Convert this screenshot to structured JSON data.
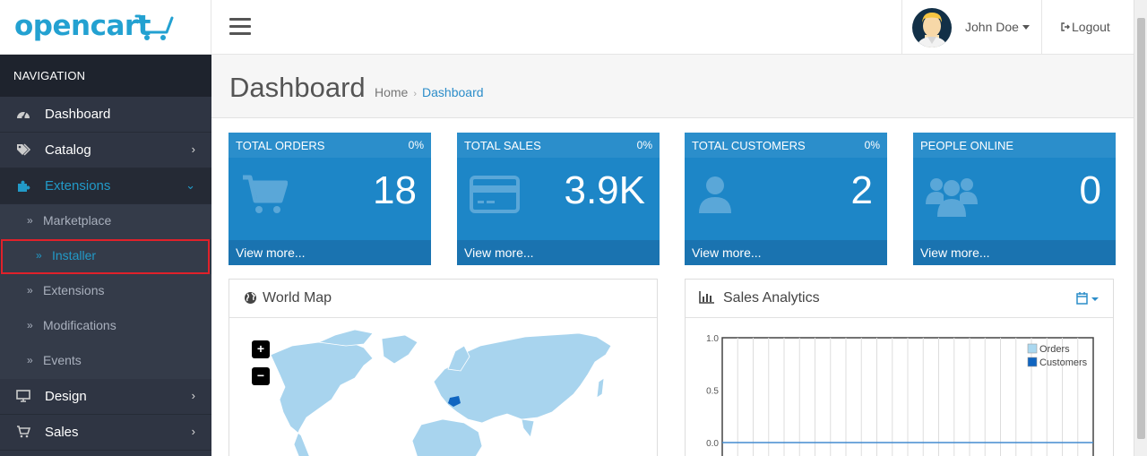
{
  "header": {
    "logo_text": "opencart",
    "user_name": "John Doe",
    "logout_label": "Logout"
  },
  "sidebar": {
    "heading": "NAVIGATION",
    "items": [
      {
        "label": "Dashboard",
        "icon": "dashboard-icon"
      },
      {
        "label": "Catalog",
        "icon": "tags-icon"
      },
      {
        "label": "Extensions",
        "icon": "puzzle-icon"
      },
      {
        "label": "Design",
        "icon": "monitor-icon"
      },
      {
        "label": "Sales",
        "icon": "cart-icon"
      }
    ],
    "extensions_sub": [
      {
        "label": "Marketplace"
      },
      {
        "label": "Installer"
      },
      {
        "label": "Extensions"
      },
      {
        "label": "Modifications"
      },
      {
        "label": "Events"
      }
    ]
  },
  "page": {
    "title": "Dashboard",
    "breadcrumb": [
      "Home",
      "Dashboard"
    ]
  },
  "tiles": [
    {
      "title": "TOTAL ORDERS",
      "percent": "0%",
      "value": "18",
      "link": "View more...",
      "icon": "cart-icon"
    },
    {
      "title": "TOTAL SALES",
      "percent": "0%",
      "value": "3.9K",
      "link": "View more...",
      "icon": "credit-card-icon"
    },
    {
      "title": "TOTAL CUSTOMERS",
      "percent": "0%",
      "value": "2",
      "link": "View more...",
      "icon": "user-icon"
    },
    {
      "title": "PEOPLE ONLINE",
      "percent": "",
      "value": "0",
      "link": "View more...",
      "icon": "users-icon"
    }
  ],
  "world_map": {
    "title": "World Map",
    "zoom_in": "+",
    "zoom_out": "−"
  },
  "sales_analytics": {
    "title": "Sales Analytics",
    "legend": [
      "Orders",
      "Customers"
    ],
    "y_ticks": [
      "1.0",
      "0.5",
      "0.0"
    ]
  },
  "colors": {
    "accent": "#229ac8",
    "tile_bg": "#1d86c7",
    "sidebar_bg": "#2f3543",
    "highlight_border": "#e0212a",
    "orders_series": "#aad8f0",
    "customers_series": "#1065c0"
  },
  "chart_data": {
    "type": "line",
    "title": "Sales Analytics",
    "ylim": [
      0,
      1.0
    ],
    "y_ticks": [
      0.0,
      0.5,
      1.0
    ],
    "series": [
      {
        "name": "Orders",
        "values": [
          0,
          0,
          0,
          0,
          0,
          0,
          0,
          0,
          0,
          0,
          0,
          0,
          0,
          0,
          0,
          0,
          0,
          0,
          0,
          0,
          0,
          0,
          0,
          0
        ]
      },
      {
        "name": "Customers",
        "values": [
          0,
          0,
          0,
          0,
          0,
          0,
          0,
          0,
          0,
          0,
          0,
          0,
          0,
          0,
          0,
          0,
          0,
          0,
          0,
          0,
          0,
          0,
          0,
          0
        ]
      }
    ],
    "grid": true,
    "legend_position": "top-right"
  }
}
